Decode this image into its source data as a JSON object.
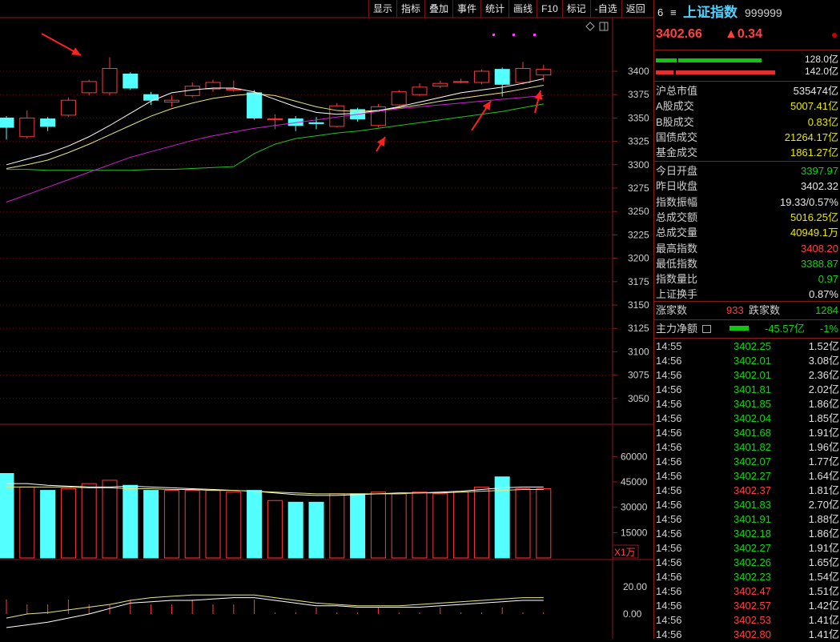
{
  "toolbar": [
    "显示",
    "指标",
    "叠加",
    "事件",
    "统计",
    "画线",
    "F10",
    "标记",
    "-自选",
    "返回"
  ],
  "header": {
    "num": "6",
    "menu_glyph": "≡",
    "name": "上证指数",
    "code": "999999",
    "price": "3402.66",
    "change": "▲0.34"
  },
  "bars": {
    "up_value": "128.0亿",
    "down_value": "142.0亿"
  },
  "stats1": [
    {
      "label": "沪总市值",
      "value": "535474亿",
      "color": "#e8e8e8"
    },
    {
      "label": "A股成交",
      "value": "5007.41亿",
      "color": "#e8e800"
    },
    {
      "label": "B股成交",
      "value": "0.83亿",
      "color": "#e8e800"
    },
    {
      "label": "国债成交",
      "value": "21264.17亿",
      "color": "#e8e800"
    },
    {
      "label": "基金成交",
      "value": "1861.27亿",
      "color": "#e8e800"
    }
  ],
  "stats2": [
    {
      "label": "今日开盘",
      "value": "3397.97",
      "color": "#11d411"
    },
    {
      "label": "昨日收盘",
      "value": "3402.32",
      "color": "#e8e8e8"
    },
    {
      "label": "指数振幅",
      "value": "19.33/0.57%",
      "color": "#e8e8e8"
    },
    {
      "label": "总成交额",
      "value": "5016.25亿",
      "color": "#e8e800"
    },
    {
      "label": "总成交量",
      "value": "40949.1万",
      "color": "#e8e800"
    },
    {
      "label": "最高指数",
      "value": "3408.20",
      "color": "#ff4040"
    },
    {
      "label": "最低指数",
      "value": "3388.87",
      "color": "#11d411"
    },
    {
      "label": "指数量比",
      "value": "0.97",
      "color": "#11d411"
    },
    {
      "label": "上证换手",
      "value": "0.87%",
      "color": "#e8e8e8"
    }
  ],
  "breadth": {
    "up_label": "涨家数",
    "up_value": "933",
    "down_label": "跌家数",
    "down_value": "1284"
  },
  "mainflow": {
    "label": "主力净额",
    "value": "-45.57亿",
    "pct": "-1%"
  },
  "ticks": [
    {
      "t": "14:55",
      "p": "3402.25",
      "v": "1.52亿",
      "c": "#11d411"
    },
    {
      "t": "14:56",
      "p": "3402.01",
      "v": "3.08亿",
      "c": "#11d411"
    },
    {
      "t": "14:56",
      "p": "3402.01",
      "v": "2.36亿",
      "c": "#11d411"
    },
    {
      "t": "14:56",
      "p": "3401.81",
      "v": "2.02亿",
      "c": "#11d411"
    },
    {
      "t": "14:56",
      "p": "3401.85",
      "v": "1.86亿",
      "c": "#11d411"
    },
    {
      "t": "14:56",
      "p": "3402.04",
      "v": "1.85亿",
      "c": "#11d411"
    },
    {
      "t": "14:56",
      "p": "3401.68",
      "v": "1.91亿",
      "c": "#11d411"
    },
    {
      "t": "14:56",
      "p": "3401.82",
      "v": "1.96亿",
      "c": "#11d411"
    },
    {
      "t": "14:56",
      "p": "3402.07",
      "v": "1.77亿",
      "c": "#11d411"
    },
    {
      "t": "14:56",
      "p": "3402.27",
      "v": "1.64亿",
      "c": "#11d411"
    },
    {
      "t": "14:56",
      "p": "3402.37",
      "v": "1.81亿",
      "c": "#ff4040"
    },
    {
      "t": "14:56",
      "p": "3401.83",
      "v": "2.70亿",
      "c": "#11d411"
    },
    {
      "t": "14:56",
      "p": "3401.91",
      "v": "1.88亿",
      "c": "#11d411"
    },
    {
      "t": "14:56",
      "p": "3402.18",
      "v": "1.86亿",
      "c": "#11d411"
    },
    {
      "t": "14:56",
      "p": "3402.27",
      "v": "1.91亿",
      "c": "#11d411"
    },
    {
      "t": "14:56",
      "p": "3402.26",
      "v": "1.65亿",
      "c": "#11d411"
    },
    {
      "t": "14:56",
      "p": "3402.23",
      "v": "1.54亿",
      "c": "#11d411"
    },
    {
      "t": "14:56",
      "p": "3402.47",
      "v": "1.51亿",
      "c": "#ff4040"
    },
    {
      "t": "14:56",
      "p": "3402.57",
      "v": "1.42亿",
      "c": "#ff4040"
    },
    {
      "t": "14:56",
      "p": "3402.53",
      "v": "1.41亿",
      "c": "#ff4040"
    },
    {
      "t": "14:56",
      "p": "3402.80",
      "v": "1.41亿",
      "c": "#ff4040"
    }
  ],
  "chart_data": {
    "type": "candlestick",
    "price_ticks": [
      3400,
      3375,
      3350,
      3325,
      3300,
      3275,
      3250,
      3225,
      3200,
      3175,
      3150,
      3125,
      3100,
      3075,
      3050
    ],
    "volume_ticks": [
      "60000",
      "45000",
      "30000",
      "15000"
    ],
    "volume_unit": "X1万",
    "macd_ticks": [
      "20.00",
      "0.00"
    ],
    "candles": [
      {
        "o": 3350,
        "c": 3340,
        "h": 3352,
        "l": 3327,
        "v": 50000
      },
      {
        "o": 3330,
        "c": 3350,
        "h": 3358,
        "l": 3328,
        "v": 42000
      },
      {
        "o": 3349,
        "c": 3341,
        "h": 3351,
        "l": 3336,
        "v": 40000
      },
      {
        "o": 3353,
        "c": 3369,
        "h": 3372,
        "l": 3351,
        "v": 41000
      },
      {
        "o": 3377,
        "c": 3389,
        "h": 3391,
        "l": 3374,
        "v": 44000
      },
      {
        "o": 3377,
        "c": 3403,
        "h": 3415,
        "l": 3374,
        "v": 46000
      },
      {
        "o": 3397,
        "c": 3382,
        "h": 3399,
        "l": 3380,
        "v": 43000
      },
      {
        "o": 3375,
        "c": 3369,
        "h": 3378,
        "l": 3364,
        "v": 40000
      },
      {
        "o": 3367,
        "c": 3369,
        "h": 3374,
        "l": 3362,
        "v": 40000
      },
      {
        "o": 3374,
        "c": 3384,
        "h": 3388,
        "l": 3372,
        "v": 40000
      },
      {
        "o": 3381,
        "c": 3388,
        "h": 3391,
        "l": 3378,
        "v": 40000
      },
      {
        "o": 3380,
        "c": 3381,
        "h": 3390,
        "l": 3378,
        "v": 39000
      },
      {
        "o": 3377,
        "c": 3350,
        "h": 3380,
        "l": 3348,
        "v": 40000
      },
      {
        "o": 3348,
        "c": 3349,
        "h": 3354,
        "l": 3338,
        "v": 34000
      },
      {
        "o": 3349,
        "c": 3342,
        "h": 3352,
        "l": 3336,
        "v": 33000
      },
      {
        "o": 3345,
        "c": 3344,
        "h": 3351,
        "l": 3338,
        "v": 33000
      },
      {
        "o": 3341,
        "c": 3363,
        "h": 3366,
        "l": 3340,
        "v": 38000
      },
      {
        "o": 3359,
        "c": 3349,
        "h": 3361,
        "l": 3346,
        "v": 38000
      },
      {
        "o": 3342,
        "c": 3362,
        "h": 3365,
        "l": 3340,
        "v": 39000
      },
      {
        "o": 3364,
        "c": 3378,
        "h": 3380,
        "l": 3362,
        "v": 38000
      },
      {
        "o": 3375,
        "c": 3383,
        "h": 3387,
        "l": 3373,
        "v": 39000
      },
      {
        "o": 3384,
        "c": 3387,
        "h": 3390,
        "l": 3382,
        "v": 38000
      },
      {
        "o": 3388,
        "c": 3389,
        "h": 3392,
        "l": 3387,
        "v": 39000
      },
      {
        "o": 3388,
        "c": 3400,
        "h": 3402,
        "l": 3386,
        "v": 42000
      },
      {
        "o": 3402,
        "c": 3386,
        "h": 3404,
        "l": 3373,
        "v": 48000
      },
      {
        "o": 3388,
        "c": 3403,
        "h": 3410,
        "l": 3386,
        "v": 41000
      },
      {
        "o": 3396,
        "c": 3402,
        "h": 3407,
        "l": 3389,
        "v": 41000
      }
    ],
    "ma_white": [
      3300,
      3306,
      3312,
      3320,
      3330,
      3342,
      3355,
      3368,
      3377,
      3380,
      3382,
      3382,
      3378,
      3370,
      3362,
      3356,
      3354,
      3355,
      3358,
      3362,
      3367,
      3372,
      3377,
      3380,
      3383,
      3387,
      3392
    ],
    "ma_yellow": [
      3296,
      3300,
      3305,
      3313,
      3322,
      3332,
      3342,
      3352,
      3360,
      3366,
      3371,
      3374,
      3376,
      3374,
      3368,
      3362,
      3358,
      3357,
      3358,
      3361,
      3364,
      3368,
      3371,
      3374,
      3377,
      3381,
      3385
    ],
    "ma_magenta": [
      3260,
      3268,
      3276,
      3284,
      3292,
      3300,
      3308,
      3314,
      3320,
      3326,
      3331,
      3335,
      3339,
      3342,
      3345,
      3348,
      3351,
      3354,
      3357,
      3360,
      3362,
      3364,
      3366,
      3368,
      3370,
      3372,
      3374
    ],
    "ma_green": [
      3295,
      3295,
      3294,
      3294,
      3294,
      3294,
      3294,
      3295,
      3295,
      3296,
      3297,
      3298,
      3312,
      3322,
      3328,
      3331,
      3334,
      3336,
      3339,
      3342,
      3345,
      3348,
      3351,
      3354,
      3357,
      3361,
      3365
    ],
    "vol_ma1": [
      44000,
      44000,
      43000,
      42500,
      42000,
      42000,
      42500,
      42000,
      41500,
      41000,
      40500,
      40000,
      39500,
      38500,
      37500,
      37000,
      37000,
      37500,
      38000,
      38500,
      38500,
      39000,
      39500,
      40500,
      41500,
      42000,
      42000
    ],
    "vol_ma2": [
      42000,
      42000,
      42000,
      42000,
      41500,
      41500,
      41000,
      41000,
      40500,
      40500,
      40000,
      40000,
      39500,
      39000,
      38500,
      38000,
      38000,
      38000,
      38000,
      38000,
      38500,
      38500,
      39000,
      39500,
      40000,
      40500,
      40500
    ],
    "macd_white": [
      -10,
      -8,
      -6,
      -3,
      0,
      4,
      8,
      9,
      10,
      10,
      11,
      12,
      12,
      10,
      8,
      6,
      6,
      5,
      5,
      5,
      5,
      6,
      7,
      8,
      9,
      10,
      10
    ],
    "macd_yellow": [
      -3,
      0,
      1,
      3,
      5,
      7,
      10,
      12,
      13,
      14,
      14,
      14,
      14,
      12,
      10,
      8,
      7,
      6,
      6,
      6,
      7,
      8,
      9,
      10,
      11,
      12,
      12
    ]
  }
}
